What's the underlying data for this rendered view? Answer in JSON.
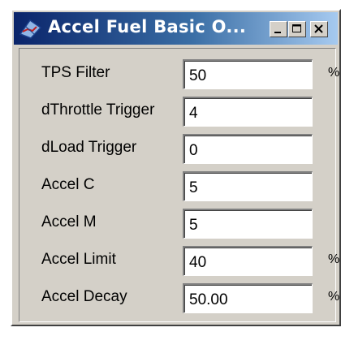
{
  "window": {
    "title": "Accel Fuel Basic O...",
    "icon": "fuel-map-icon",
    "controls": [
      "minimize-icon",
      "maximize-icon",
      "close-icon"
    ]
  },
  "fields": [
    {
      "label": "TPS Filter",
      "value": "50",
      "unit": "%"
    },
    {
      "label": "dThrottle Trigger",
      "value": "4",
      "unit": ""
    },
    {
      "label": "dLoad Trigger",
      "value": "0",
      "unit": ""
    },
    {
      "label": "Accel C",
      "value": "5",
      "unit": ""
    },
    {
      "label": "Accel M",
      "value": "5",
      "unit": ""
    },
    {
      "label": "Accel Limit",
      "value": "40",
      "unit": "%"
    },
    {
      "label": "Accel Decay",
      "value": "50.00",
      "unit": "%"
    }
  ],
  "colors": {
    "titlebar_start": "#0a246a",
    "titlebar_end": "#a6caf0",
    "window_face": "#d4d0c8"
  }
}
